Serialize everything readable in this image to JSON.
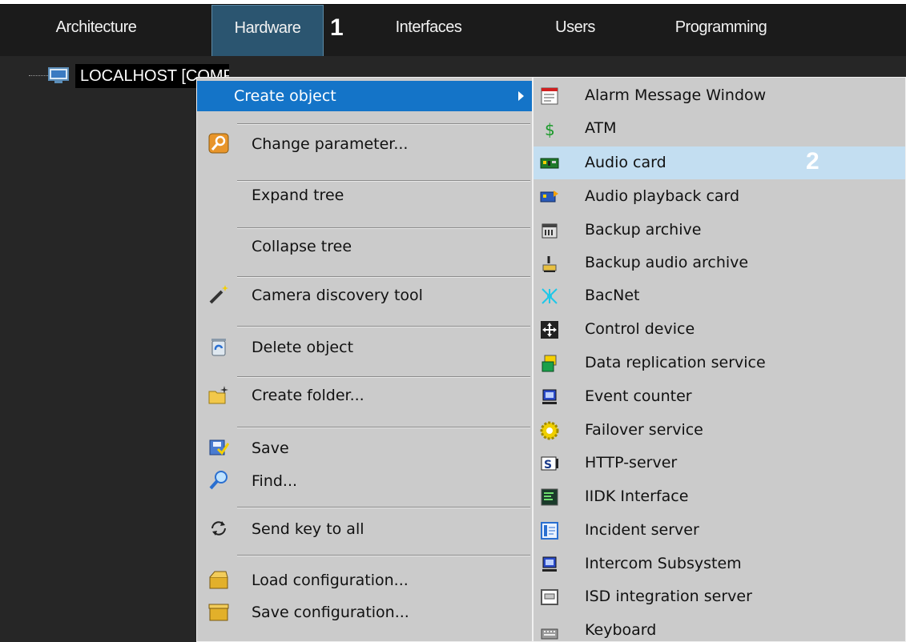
{
  "tabs": [
    {
      "label": "Architecture",
      "active": false
    },
    {
      "label": "Hardware",
      "active": true
    },
    {
      "label": "Interfaces",
      "active": false
    },
    {
      "label": "Users",
      "active": false
    },
    {
      "label": "Programming",
      "active": false
    }
  ],
  "annotations": {
    "one": "1",
    "two": "2"
  },
  "tree": {
    "root_label": "LOCALHOST [COMPUTER]",
    "root_icon": "computer-icon"
  },
  "context_menu": {
    "items": [
      {
        "label": "Create object",
        "icon": "none",
        "highlighted": true,
        "has_submenu": true
      },
      {
        "label": "Change parameter...",
        "icon": "key-icon"
      },
      {
        "label": "Expand tree",
        "icon": "none"
      },
      {
        "label": "Collapse tree",
        "icon": "none"
      },
      {
        "label": "Camera discovery tool",
        "icon": "wand-icon"
      },
      {
        "label": "Delete object",
        "icon": "recycle-bin-icon"
      },
      {
        "label": "Create folder...",
        "icon": "new-folder-icon"
      },
      {
        "label": "Save",
        "icon": "save-icon"
      },
      {
        "label": "Find...",
        "icon": "magnifier-icon"
      },
      {
        "label": "Send key to all",
        "icon": "refresh-icon"
      },
      {
        "label": "Load configuration...",
        "icon": "open-box-icon"
      },
      {
        "label": "Save configuration...",
        "icon": "closed-box-icon"
      }
    ]
  },
  "submenu": {
    "items": [
      {
        "label": "Alarm Message Window",
        "icon": "message-window-icon"
      },
      {
        "label": "ATM",
        "icon": "dollar-icon"
      },
      {
        "label": "Audio card",
        "icon": "audio-card-icon",
        "highlighted": true
      },
      {
        "label": "Audio playback card",
        "icon": "playback-card-icon"
      },
      {
        "label": "Backup archive",
        "icon": "archive-icon"
      },
      {
        "label": "Backup audio archive",
        "icon": "audio-archive-icon"
      },
      {
        "label": "BacNet",
        "icon": "network-icon"
      },
      {
        "label": "Control device",
        "icon": "move-arrows-icon"
      },
      {
        "label": "Data replication service",
        "icon": "replication-icon"
      },
      {
        "label": "Event counter",
        "icon": "monitor-icon"
      },
      {
        "label": "Failover service",
        "icon": "gear-icon"
      },
      {
        "label": "HTTP-server",
        "icon": "http-server-icon"
      },
      {
        "label": "IIDK Interface",
        "icon": "terminal-icon"
      },
      {
        "label": "Incident server",
        "icon": "incident-server-icon"
      },
      {
        "label": "Intercom Subsystem",
        "icon": "monitor-icon"
      },
      {
        "label": "ISD integration server",
        "icon": "isd-server-icon"
      },
      {
        "label": "Keyboard",
        "icon": "keyboard-icon"
      }
    ]
  },
  "colors": {
    "tab_bar": "#1b1b1b",
    "active_tab": "#2b5570",
    "tree_bg": "#262626",
    "menu_bg": "#cbcbcb",
    "menu_highlight": "#1474c8",
    "submenu_highlight": "#c3def1"
  }
}
